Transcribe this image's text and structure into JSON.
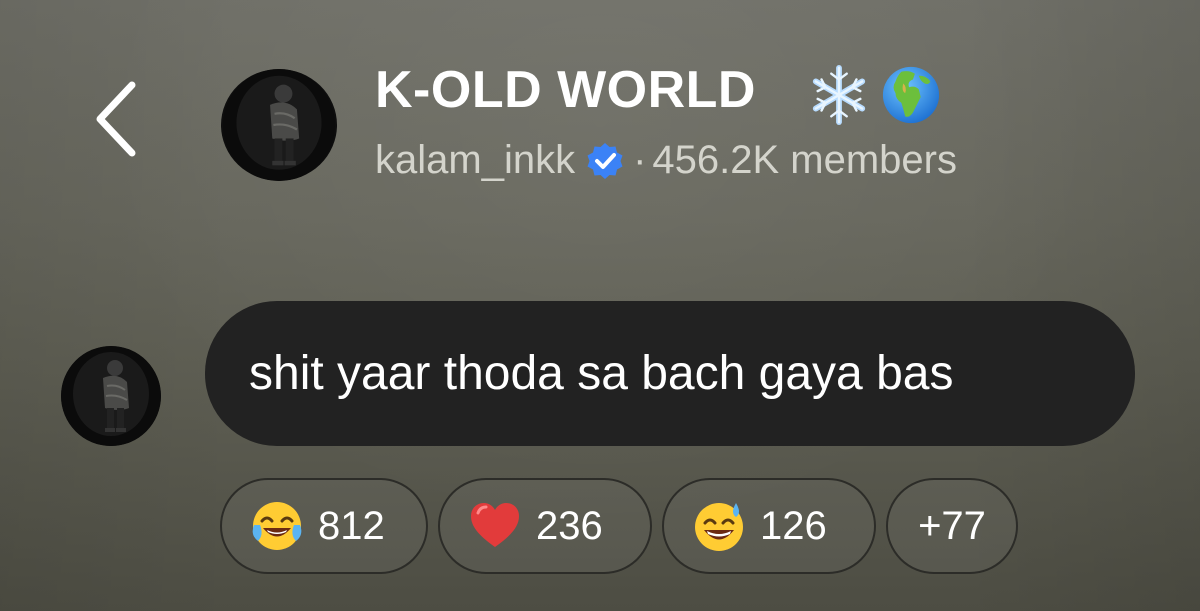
{
  "header": {
    "back_icon": "chevron-left-icon",
    "channel_name": "K-OLD WORLD",
    "title_emojis": [
      "snowflake",
      "globe-europe-africa"
    ],
    "owner_handle": "kalam_inkk",
    "separator": "·",
    "members": "456.2K members"
  },
  "message": {
    "text": "shit yaar thoda sa bach gaya bas"
  },
  "reactions": [
    {
      "emoji": "face-with-tears-of-joy",
      "count": "812"
    },
    {
      "emoji": "red-heart",
      "count": "236"
    },
    {
      "emoji": "grinning-face-with-sweat",
      "count": "126"
    },
    {
      "emoji": "",
      "count": "+77"
    }
  ],
  "colors": {
    "bubble": "#222222",
    "verified": "#3b82f6",
    "subtitle": "#d4d4cc"
  }
}
